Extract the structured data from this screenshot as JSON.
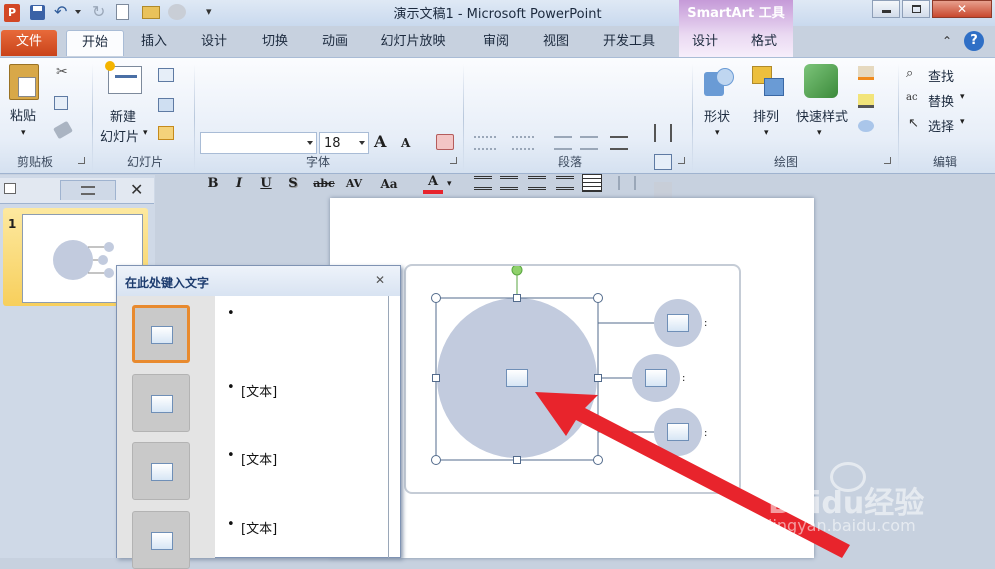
{
  "window": {
    "title": "演示文稿1 - Microsoft PowerPoint",
    "contextual_group": "SmartArt 工具"
  },
  "tabs": [
    "文件",
    "开始",
    "插入",
    "设计",
    "切换",
    "动画",
    "幻灯片放映",
    "审阅",
    "视图",
    "开发工具",
    "设计",
    "格式"
  ],
  "ribbon": {
    "clipboard": {
      "paste": "粘贴",
      "group": "剪贴板"
    },
    "slides": {
      "new_slide_1": "新建",
      "new_slide_2": "幻灯片",
      "group": "幻灯片"
    },
    "font": {
      "size": "18",
      "group": "字体",
      "bold": "B",
      "italic": "I",
      "underline": "U",
      "shadow": "S",
      "strike": "abc",
      "spacing": "AV",
      "case": "Aa",
      "color": "A",
      "grow": "A",
      "shrink": "A"
    },
    "paragraph": {
      "group": "段落"
    },
    "drawing": {
      "shapes": "形状",
      "arrange": "排列",
      "quick_styles": "快速样式",
      "group": "绘图"
    },
    "editing": {
      "find": "查找",
      "replace": "替换",
      "select": "选择",
      "group": "编辑"
    }
  },
  "thumbnails": [
    {
      "number": "1"
    }
  ],
  "text_pane": {
    "title": "在此处键入文字",
    "items": [
      "",
      "[文本]",
      "[文本]",
      "[文本]"
    ]
  },
  "watermark": {
    "brand": "Baidu经验",
    "url": "jingyan.baidu.com"
  },
  "colors": {
    "accent_file": "#d9532a",
    "smartart_fill": "#c2cbde",
    "selection_border": "#e88a2e",
    "arrow": "#e8242c"
  }
}
